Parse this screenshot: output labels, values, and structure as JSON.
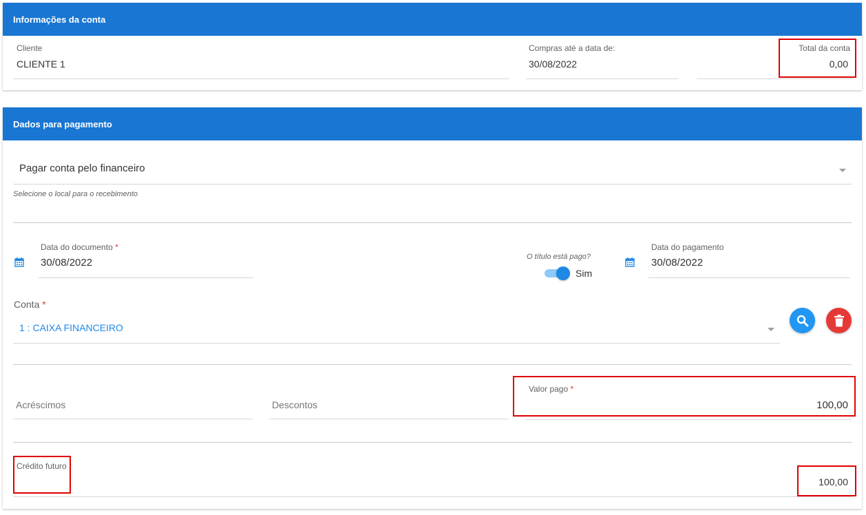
{
  "account_info": {
    "header": "Informações da conta",
    "client_label": "Cliente",
    "client_value": "CLIENTE 1",
    "purchases_label": "Compras até a data de:",
    "purchases_value": "30/08/2022",
    "total_label": "Total da conta",
    "total_value": "0,00"
  },
  "payment": {
    "header": "Dados para pagamento",
    "pay_mode_value": "Pagar conta pelo financeiro",
    "pay_mode_hint": "Selecione o local para o recebimento",
    "doc_date_label": "Data do documento",
    "doc_date_value": "30/08/2022",
    "paid_question": "O título está pago?",
    "paid_toggle_label": "Sim",
    "pay_date_label": "Data do pagamento",
    "pay_date_value": "30/08/2022",
    "account_label": "Conta",
    "account_value": "1 : CAIXA FINANCEIRO",
    "additions_placeholder": "Acréscimos",
    "discounts_placeholder": "Descontos",
    "paid_value_label": "Valor pago",
    "paid_value": "100,00",
    "future_credit_label": "Crédito futuro",
    "future_credit_value": "100,00",
    "required_mark": "*"
  },
  "icons": {
    "calendar": "calendar-icon",
    "search": "search-icon",
    "delete": "trash-icon",
    "dropdown": "chevron-down-icon"
  },
  "colors": {
    "header_bg": "#1976d2",
    "link_blue": "#1e88e5",
    "search_btn": "#2196f3",
    "delete_btn": "#e53935",
    "highlight": "#e00000"
  }
}
